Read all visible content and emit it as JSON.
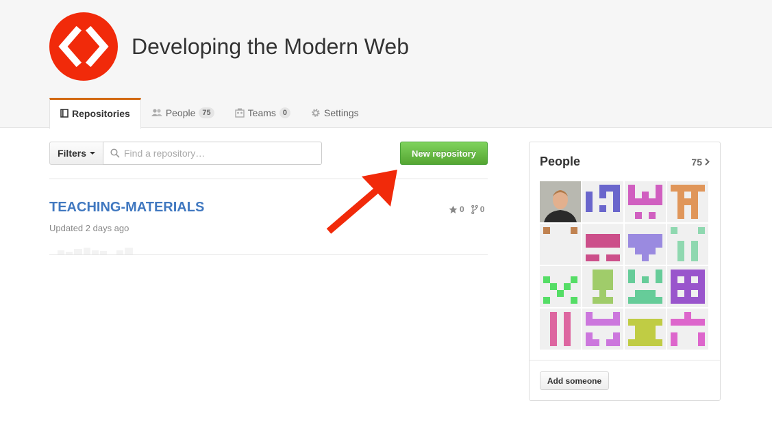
{
  "org": {
    "name": "Developing the Modern Web",
    "logo_color": "#f12a0a"
  },
  "tabs": [
    {
      "label": "Repositories",
      "icon": "repo-icon",
      "active": true
    },
    {
      "label": "People",
      "icon": "people-icon",
      "count": "75"
    },
    {
      "label": "Teams",
      "icon": "teams-icon",
      "count": "0"
    },
    {
      "label": "Settings",
      "icon": "gear-icon"
    }
  ],
  "toolbar": {
    "filters_label": "Filters",
    "search_placeholder": "Find a repository…",
    "search_value": "",
    "new_repo_label": "New repository"
  },
  "repo": {
    "name": "TEACHING-MATERIALS",
    "updated": "Updated 2 days ago",
    "stars": "0",
    "forks": "0"
  },
  "people": {
    "title": "People",
    "count": "75",
    "add_label": "Add someone",
    "avatars": [
      {
        "name": "photo-avatar",
        "color": "#7a6a55"
      },
      {
        "name": "identicon-blue",
        "color": "#6a66cc"
      },
      {
        "name": "identicon-magenta",
        "color": "#d05fc0"
      },
      {
        "name": "identicon-orange",
        "color": "#e0965a"
      },
      {
        "name": "identicon-brown",
        "color": "#c08250"
      },
      {
        "name": "identicon-pink",
        "color": "#cc4f8a"
      },
      {
        "name": "identicon-violet",
        "color": "#9a8ae0"
      },
      {
        "name": "identicon-mint",
        "color": "#8fd8b0"
      },
      {
        "name": "identicon-green",
        "color": "#55dd66"
      },
      {
        "name": "identicon-olive",
        "color": "#a0cc6a"
      },
      {
        "name": "identicon-teal",
        "color": "#66cc99"
      },
      {
        "name": "identicon-purple",
        "color": "#9955cc"
      },
      {
        "name": "identicon-rose",
        "color": "#dd66a0"
      },
      {
        "name": "identicon-orchid",
        "color": "#cc77dd"
      },
      {
        "name": "identicon-lime",
        "color": "#c0cc44"
      },
      {
        "name": "identicon-fuchsia",
        "color": "#dd66cc"
      }
    ]
  }
}
